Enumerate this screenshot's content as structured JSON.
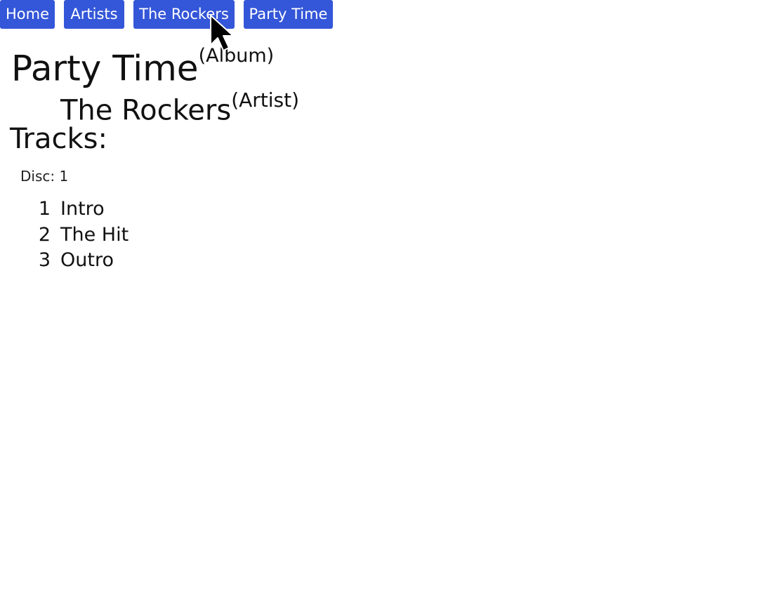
{
  "nav": {
    "items": [
      {
        "label": "Home"
      },
      {
        "label": "Artists"
      },
      {
        "label": "The Rockers"
      },
      {
        "label": "Party Time"
      }
    ]
  },
  "album": {
    "title": "Party Time",
    "type_label": "(Album)",
    "artist": "The Rockers",
    "artist_type_label": "(Artist)"
  },
  "tracks_section": {
    "heading": "Tracks:",
    "disc_label": "Disc: 1",
    "tracks": [
      {
        "number": "1",
        "title": "Intro"
      },
      {
        "number": "2",
        "title": "The Hit"
      },
      {
        "number": "3",
        "title": "Outro"
      }
    ]
  },
  "colors": {
    "nav_button_bg": "#3456d8",
    "nav_button_text": "#ffffff",
    "text": "#111111"
  },
  "icons": {
    "cursor": "mouse-pointer-icon"
  }
}
